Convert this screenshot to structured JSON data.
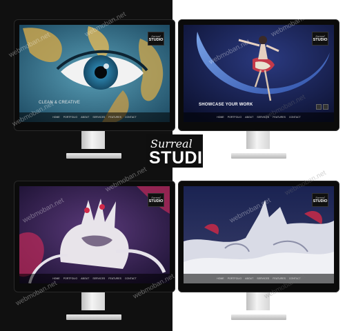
{
  "brand": {
    "script": "Surreal",
    "title": "STUDIO"
  },
  "screen_logo": {
    "line1": "Surreal",
    "line2": "STUDIO"
  },
  "nav": [
    "HOME",
    "PORTFOLIO",
    "ABOUT",
    "SERVICES",
    "FEATURES",
    "CONTACT"
  ],
  "slides": {
    "eye": {
      "tagline": "CLEAN & CREATIVE"
    },
    "moon": {
      "tagline": "SHOWCASE YOUR WORK"
    }
  },
  "watermark": "webmoban.net",
  "colors": {
    "left_bg": "#101010",
    "right_bg": "#ffffff",
    "accent_pink": "#d0306a",
    "navy": "#141c4a"
  }
}
